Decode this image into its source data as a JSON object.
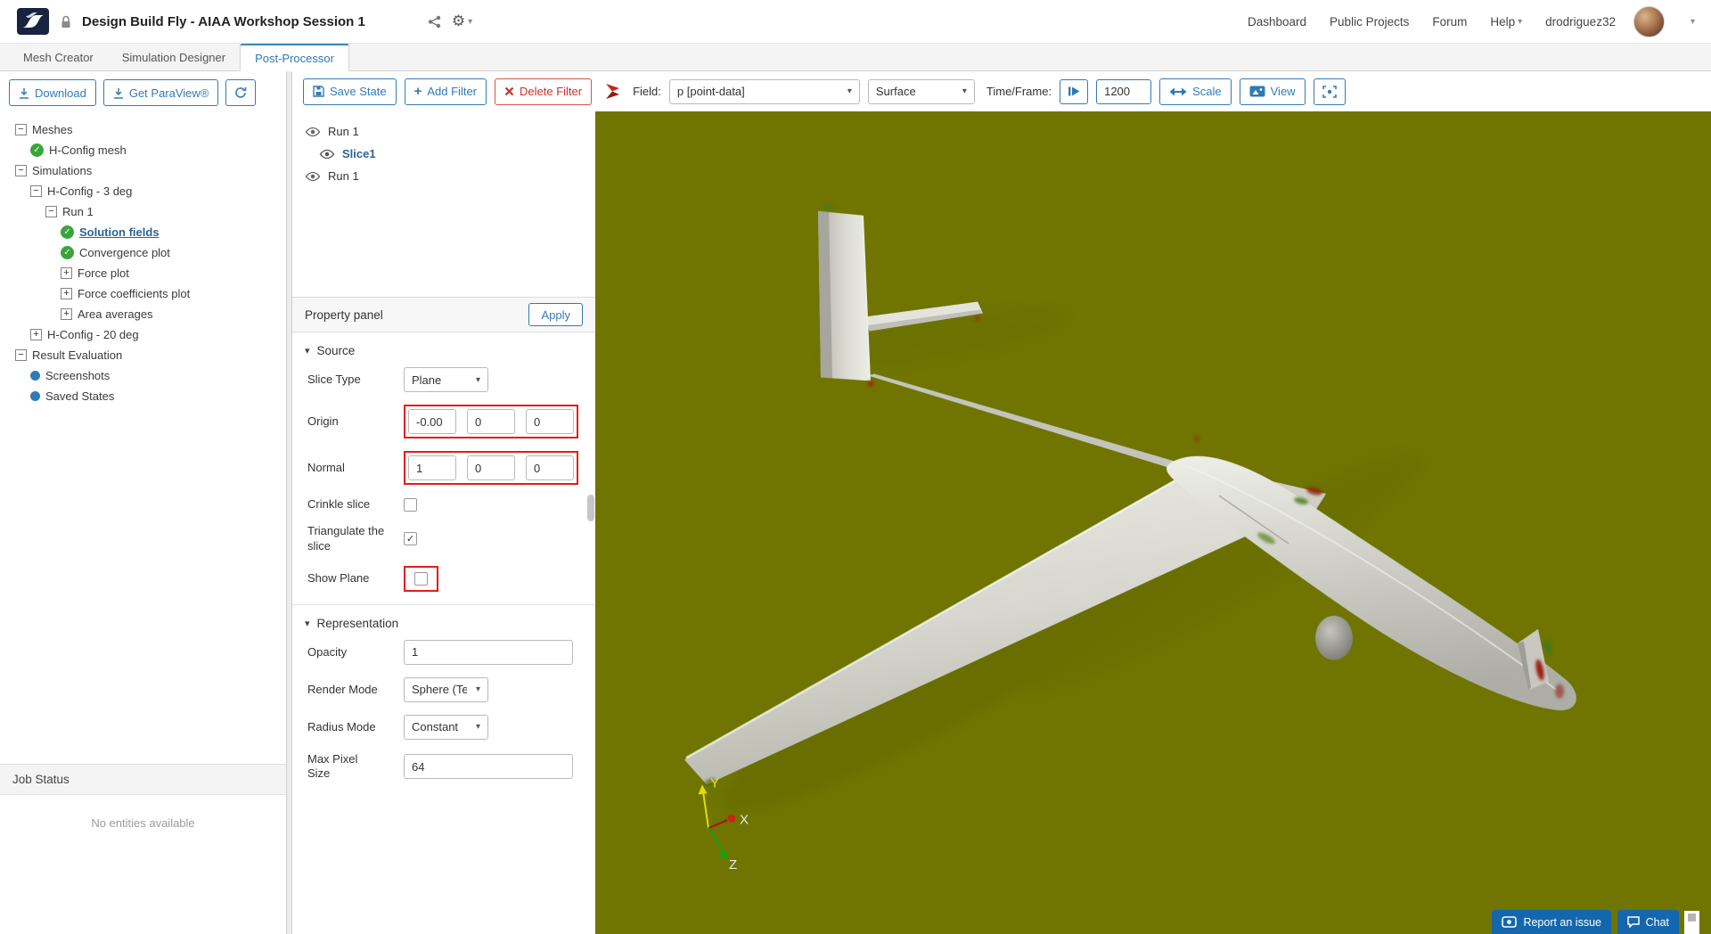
{
  "icons": {
    "minus": "−",
    "plus": "+",
    "check": "✓",
    "caret_down": "▾",
    "gear": "⚙"
  },
  "colors": {
    "accent_blue": "#337ab7",
    "danger_red": "#c9302c",
    "annotation_red": "#e41d1d",
    "selection_blue": "#2a6496",
    "viewport_olive": "#6f7500",
    "overlay_button_blue": "#1467ad"
  },
  "header": {
    "title": "Design Build Fly - AIAA Workshop Session 1",
    "nav": {
      "dashboard": "Dashboard",
      "public_projects": "Public Projects",
      "forum": "Forum",
      "help": "Help",
      "username": "drodriguez32"
    }
  },
  "tabs": {
    "mesh_creator": "Mesh Creator",
    "simulation_designer": "Simulation Designer",
    "post_processor": "Post-Processor"
  },
  "sidebar": {
    "download_label": "Download",
    "paraview_label": "Get ParaView®",
    "tree": [
      {
        "icon": "minus-box",
        "depth": 0,
        "label": "Meshes"
      },
      {
        "icon": "check",
        "depth": 1,
        "label": "H-Config mesh"
      },
      {
        "icon": "minus-box",
        "depth": 0,
        "label": "Simulations"
      },
      {
        "icon": "minus-box",
        "depth": 1,
        "label": "H-Config - 3 deg"
      },
      {
        "icon": "minus-box",
        "depth": 2,
        "label": "Run 1"
      },
      {
        "icon": "check",
        "depth": 3,
        "label": "Solution fields",
        "selected": true
      },
      {
        "icon": "check",
        "depth": 3,
        "label": "Convergence plot"
      },
      {
        "icon": "plus-box",
        "depth": 3,
        "label": "Force plot"
      },
      {
        "icon": "plus-box",
        "depth": 3,
        "label": "Force coefficients plot"
      },
      {
        "icon": "plus-box",
        "depth": 3,
        "label": "Area averages"
      },
      {
        "icon": "plus-box",
        "depth": 1,
        "label": "H-Config - 20 deg"
      },
      {
        "icon": "minus-box",
        "depth": 0,
        "label": "Result Evaluation"
      },
      {
        "icon": "dot",
        "depth": 1,
        "label": "Screenshots"
      },
      {
        "icon": "dot",
        "depth": 1,
        "label": "Saved States"
      }
    ],
    "job_status": {
      "title": "Job Status",
      "empty_text": "No entities available"
    }
  },
  "toolbar": {
    "save_state": "Save State",
    "add_filter": "Add Filter",
    "delete_filter": "Delete Filter",
    "field_label": "Field:",
    "field_value": "p [point-data]",
    "representation_value": "Surface",
    "time_label": "Time/Frame:",
    "time_value": "1200",
    "scale": "Scale",
    "view": "View"
  },
  "pipeline": {
    "items": [
      {
        "label": "Run 1",
        "visible": true
      },
      {
        "label": "Slice1",
        "visible": true,
        "selected": true
      },
      {
        "label": "Run 1",
        "visible": true
      }
    ]
  },
  "property_panel": {
    "title": "Property panel",
    "apply_label": "Apply",
    "source": {
      "title": "Source",
      "slice_type": {
        "label": "Slice Type",
        "value": "Plane"
      },
      "origin": {
        "label": "Origin",
        "values": [
          "-0.00",
          "0",
          "0"
        ]
      },
      "normal": {
        "label": "Normal",
        "values": [
          "1",
          "0",
          "0"
        ]
      },
      "crinkle": {
        "label": "Crinkle slice",
        "checked": false
      },
      "triangulate": {
        "label": "Triangulate the slice",
        "checked": true
      },
      "show_plane": {
        "label": "Show Plane",
        "checked": false
      }
    },
    "representation": {
      "title": "Representation",
      "opacity": {
        "label": "Opacity",
        "value": "1"
      },
      "render_mode": {
        "label": "Render Mode",
        "value": "Sphere (Te"
      },
      "radius_mode": {
        "label": "Radius Mode",
        "value": "Constant"
      },
      "max_pixel": {
        "label": "Max Pixel Size",
        "value": "64"
      }
    }
  },
  "viewport": {
    "axis_x": "X",
    "axis_y": "Y",
    "axis_z": "Z",
    "report_issue": "Report an issue",
    "chat": "Chat"
  }
}
